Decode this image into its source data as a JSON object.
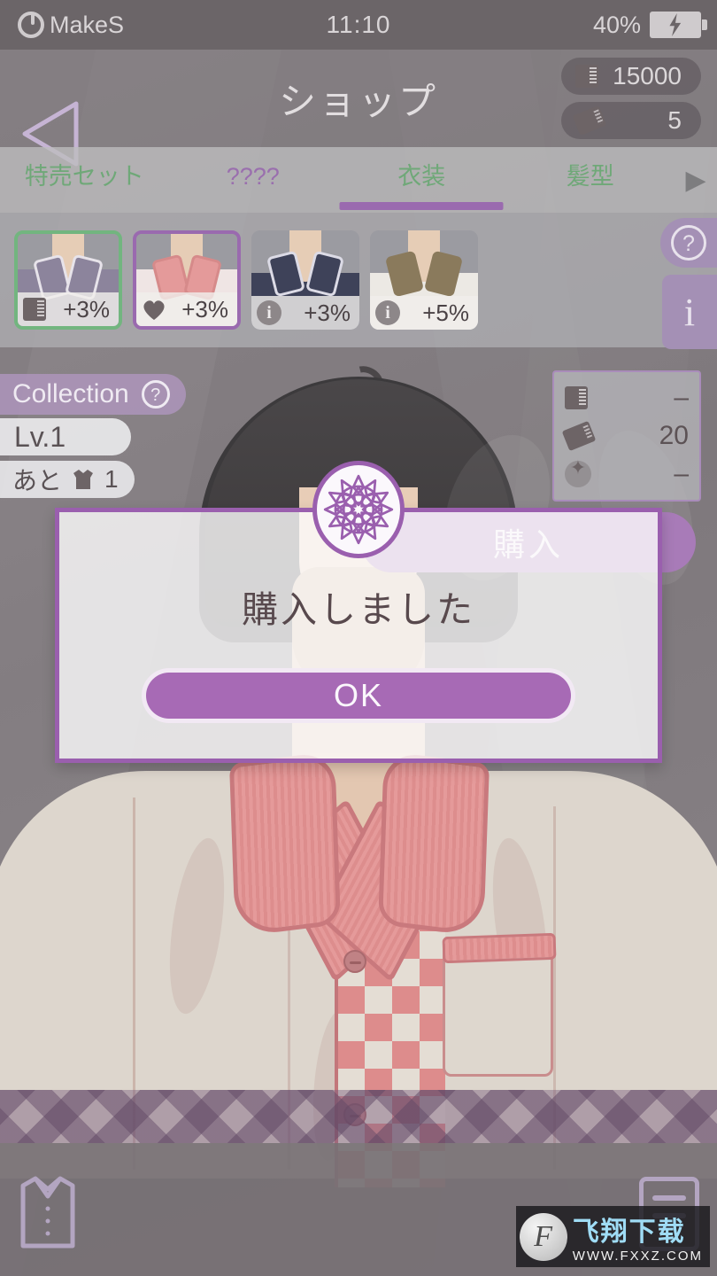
{
  "statusbar": {
    "app_name": "MakeS",
    "power_icon": "power-icon",
    "time": "11:10",
    "battery_percent": "40%",
    "battery_icon": "battery-charging-icon"
  },
  "header": {
    "back_icon": "back-arrow-icon",
    "title": "ショップ",
    "currencies": [
      {
        "icon": "money-icon",
        "value": "15000"
      },
      {
        "icon": "ticket-icon",
        "value": "5"
      }
    ]
  },
  "tabs": {
    "items": [
      {
        "label": "特売セット",
        "state": "normal"
      },
      {
        "label": "????",
        "state": "locked"
      },
      {
        "label": "衣装",
        "state": "active"
      },
      {
        "label": "髪型",
        "state": "normal"
      }
    ],
    "next_icon": "chevron-right-icon"
  },
  "items": {
    "cards": [
      {
        "icon": "money-icon",
        "bonus": "+3%",
        "selection": "green",
        "outfit_main": "#8c849c",
        "outfit_trim": "#e7e3ea",
        "outfit_under": "#d8d3d8"
      },
      {
        "icon": "heart-icon",
        "bonus": "+3%",
        "selection": "purple",
        "outfit_main": "#e49a9a",
        "outfit_trim": "#efe5e4",
        "outfit_under": "#eee7e5"
      },
      {
        "icon": "info-icon",
        "bonus": "+3%",
        "selection": "none",
        "outfit_main": "#3e4259",
        "outfit_trim": "#dcdbe6",
        "outfit_under": "#d6d5de"
      },
      {
        "icon": "info-icon",
        "bonus": "+5%",
        "selection": "none",
        "outfit_main": "#8a7a5c",
        "outfit_trim": "#ece9e4",
        "outfit_under": "#5a5567"
      }
    ]
  },
  "side_buttons": {
    "help_icon": "question-mark-icon",
    "info_label": "i"
  },
  "collection": {
    "title": "Collection",
    "help_icon": "question-mark-icon",
    "level": "Lv.1",
    "remaining_prefix": "あと",
    "remaining_icon": "shirt-icon",
    "remaining_count": "1"
  },
  "price_panel": {
    "rows": [
      {
        "icon": "money-icon",
        "value": "–"
      },
      {
        "icon": "ticket-icon",
        "value": "20"
      },
      {
        "icon": "sparkle-icon",
        "value": "–"
      }
    ]
  },
  "purchase_button": {
    "label": "購入"
  },
  "dialog": {
    "badge_icon": "mandala-rosette-icon",
    "message": "購入しました",
    "confirm_label": "OK"
  },
  "bottom_bar": {
    "left_icon": "shirt-outline-icon",
    "right_icon": "menu-list-icon"
  },
  "watermark": {
    "logo_letter": "F",
    "site_name": "飞翔下载",
    "url": "WWW.FXXZ.COM"
  },
  "colors": {
    "accent_purple": "#9a5fae",
    "button_purple": "#a76ab5",
    "tab_green": "#6fa878",
    "tab_locked": "#9a6fae",
    "background_gray": "#7e787c"
  }
}
